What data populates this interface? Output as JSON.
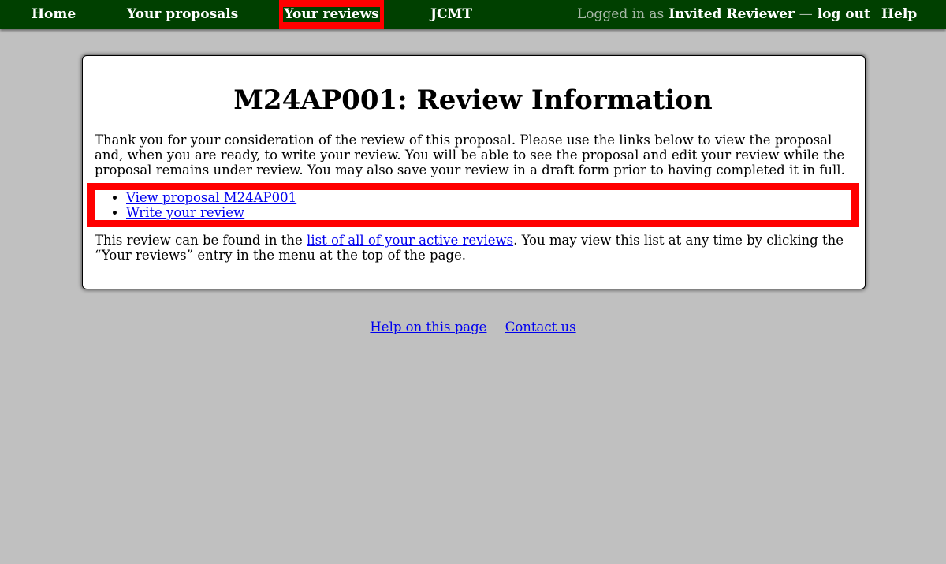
{
  "nav": {
    "home": "Home",
    "proposals": "Your proposals",
    "reviews": "Your reviews",
    "jcmt": "JCMT",
    "logged_in_as": "Logged in as",
    "user": "Invited Reviewer",
    "dash": "—",
    "logout": "log out",
    "help": "Help"
  },
  "main": {
    "title": "M24AP001: Review Information",
    "intro": "Thank you for your consideration of the review of this proposal. Please use the links below to view the proposal and, when you are ready, to write your review. You will be able to see the proposal and edit your review while the proposal remains under review. You may also save your review in a draft form prior to having completed it in full.",
    "links": [
      {
        "label": "View proposal M24AP001"
      },
      {
        "label": "Write your review"
      }
    ],
    "found_prefix": "This review can be found in the ",
    "found_link": "list of all of your active reviews",
    "found_suffix": ". You may view this list at any time by clicking the “Your reviews” entry in the menu at the top of the page."
  },
  "footer": {
    "help": "Help on this page",
    "contact": "Contact us"
  },
  "colors": {
    "nav_bg": "#004000",
    "highlight": "#ff0000",
    "page_bg": "#c0c0c0",
    "link": "#0000ee"
  }
}
